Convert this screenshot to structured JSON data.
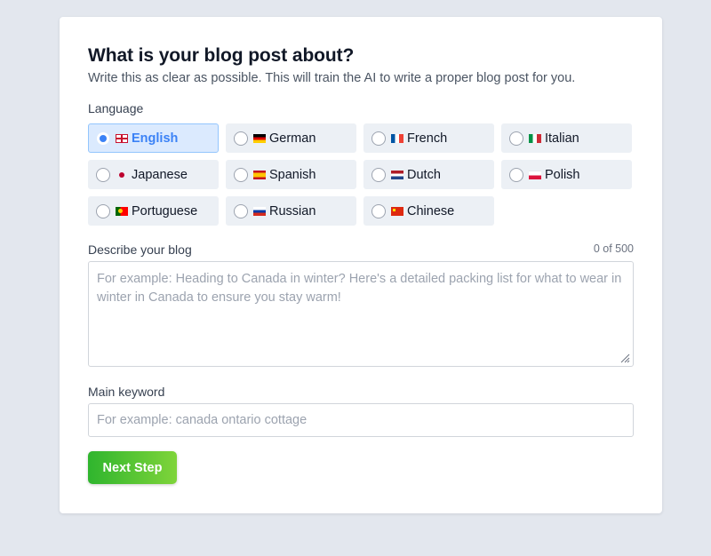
{
  "header": {
    "title": "What is your blog post about?",
    "subtitle": "Write this as clear as possible. This will train the AI to write a proper blog post for you."
  },
  "language": {
    "label": "Language",
    "selected": "English",
    "options": [
      {
        "label": "English",
        "flag": "gb-flag-icon"
      },
      {
        "label": "German",
        "flag": "de-flag-icon"
      },
      {
        "label": "French",
        "flag": "fr-flag-icon"
      },
      {
        "label": "Italian",
        "flag": "it-flag-icon"
      },
      {
        "label": "Japanese",
        "flag": "jp-flag-icon"
      },
      {
        "label": "Spanish",
        "flag": "es-flag-icon"
      },
      {
        "label": "Dutch",
        "flag": "nl-flag-icon"
      },
      {
        "label": "Polish",
        "flag": "pl-flag-icon"
      },
      {
        "label": "Portuguese",
        "flag": "pt-flag-icon"
      },
      {
        "label": "Russian",
        "flag": "ru-flag-icon"
      },
      {
        "label": "Chinese",
        "flag": "cn-flag-icon"
      }
    ]
  },
  "description": {
    "label": "Describe your blog",
    "counter": "0 of 500",
    "value": "",
    "placeholder": "For example: Heading to Canada in winter? Here's a detailed packing list for what to wear in winter in Canada to ensure you stay warm!"
  },
  "keyword": {
    "label": "Main keyword",
    "value": "",
    "placeholder": "For example: canada ontario cottage"
  },
  "actions": {
    "next_label": "Next Step"
  },
  "colors": {
    "accent": "#3b82f6",
    "button_start": "#2fb52e",
    "button_end": "#7fd43a",
    "background": "#e3e7ee"
  }
}
